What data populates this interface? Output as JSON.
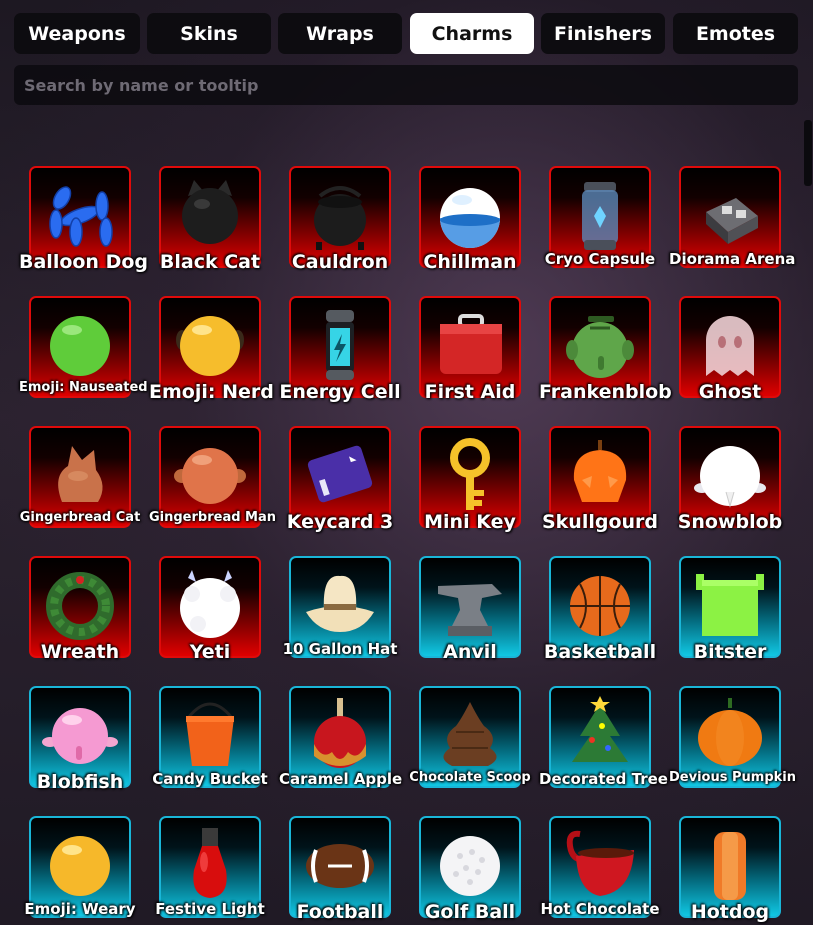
{
  "tabs": [
    "Weapons",
    "Skins",
    "Wraps",
    "Charms",
    "Finishers",
    "Emotes"
  ],
  "active_tab": "Charms",
  "search": {
    "placeholder": "Search by name or tooltip",
    "value": ""
  },
  "colors": {
    "red_border": "#e00a0a",
    "blue_border": "#19b6d8",
    "tab_active_bg": "#ffffff",
    "tab_bg": "#0d0c10"
  },
  "items": [
    {
      "label": "Balloon Dog",
      "rarity": "red",
      "icon": "balloon-dog-icon"
    },
    {
      "label": "Black Cat",
      "rarity": "red",
      "icon": "black-cat-icon"
    },
    {
      "label": "Cauldron",
      "rarity": "red",
      "icon": "cauldron-icon"
    },
    {
      "label": "Chillman",
      "rarity": "red",
      "icon": "chillman-icon"
    },
    {
      "label": "Cryo Capsule",
      "rarity": "red",
      "icon": "cryo-capsule-icon"
    },
    {
      "label": "Diorama Arena",
      "rarity": "red",
      "icon": "diorama-arena-icon"
    },
    {
      "label": "Emoji: Nauseated",
      "rarity": "red",
      "icon": "emoji-nauseated-icon"
    },
    {
      "label": "Emoji: Nerd",
      "rarity": "red",
      "icon": "emoji-nerd-icon"
    },
    {
      "label": "Energy Cell",
      "rarity": "red",
      "icon": "energy-cell-icon"
    },
    {
      "label": "First Aid",
      "rarity": "red",
      "icon": "first-aid-icon"
    },
    {
      "label": "Frankenblob",
      "rarity": "red",
      "icon": "frankenblob-icon"
    },
    {
      "label": "Ghost",
      "rarity": "red",
      "icon": "ghost-icon"
    },
    {
      "label": "Gingerbread Cat",
      "rarity": "red",
      "icon": "gingerbread-cat-icon"
    },
    {
      "label": "Gingerbread Man",
      "rarity": "red",
      "icon": "gingerbread-man-icon"
    },
    {
      "label": "Keycard 3",
      "rarity": "red",
      "icon": "keycard-icon"
    },
    {
      "label": "Mini Key",
      "rarity": "red",
      "icon": "mini-key-icon"
    },
    {
      "label": "Skullgourd",
      "rarity": "red",
      "icon": "skullgourd-icon"
    },
    {
      "label": "Snowblob",
      "rarity": "red",
      "icon": "snowblob-icon"
    },
    {
      "label": "Wreath",
      "rarity": "red",
      "icon": "wreath-icon"
    },
    {
      "label": "Yeti",
      "rarity": "red",
      "icon": "yeti-icon"
    },
    {
      "label": "10 Gallon Hat",
      "rarity": "blue",
      "icon": "cowboy-hat-icon"
    },
    {
      "label": "Anvil",
      "rarity": "blue",
      "icon": "anvil-icon"
    },
    {
      "label": "Basketball",
      "rarity": "blue",
      "icon": "basketball-icon"
    },
    {
      "label": "Bitster",
      "rarity": "blue",
      "icon": "bitster-icon"
    },
    {
      "label": "Blobfish",
      "rarity": "blue",
      "icon": "blobfish-icon"
    },
    {
      "label": "Candy Bucket",
      "rarity": "blue",
      "icon": "candy-bucket-icon"
    },
    {
      "label": "Caramel Apple",
      "rarity": "blue",
      "icon": "caramel-apple-icon"
    },
    {
      "label": "Chocolate Scoop",
      "rarity": "blue",
      "icon": "chocolate-scoop-icon"
    },
    {
      "label": "Decorated Tree",
      "rarity": "blue",
      "icon": "decorated-tree-icon"
    },
    {
      "label": "Devious Pumpkin",
      "rarity": "blue",
      "icon": "devious-pumpkin-icon"
    },
    {
      "label": "Emoji: Weary",
      "rarity": "blue",
      "icon": "emoji-weary-icon"
    },
    {
      "label": "Festive Light",
      "rarity": "blue",
      "icon": "festive-light-icon"
    },
    {
      "label": "Football",
      "rarity": "blue",
      "icon": "football-icon"
    },
    {
      "label": "Golf Ball",
      "rarity": "blue",
      "icon": "golf-ball-icon"
    },
    {
      "label": "Hot Chocolate",
      "rarity": "blue",
      "icon": "hot-chocolate-icon"
    },
    {
      "label": "Hotdog",
      "rarity": "blue",
      "icon": "hotdog-icon"
    }
  ]
}
